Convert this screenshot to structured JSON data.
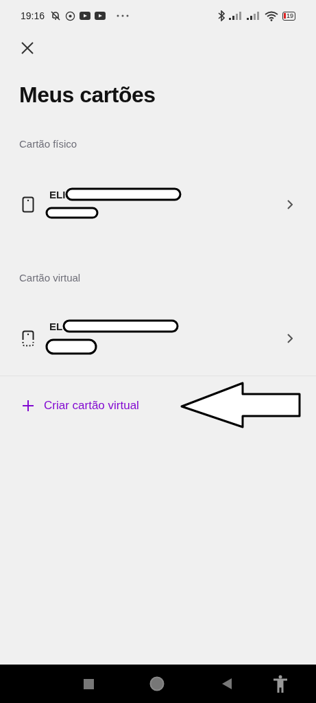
{
  "status_bar": {
    "time": "19:16",
    "battery": "19"
  },
  "title": "Meus cartões",
  "sections": [
    {
      "heading": "Cartão físico",
      "cards": [
        {
          "kind": "physical",
          "name": "ELI"
        }
      ]
    },
    {
      "heading": "Cartão virtual",
      "cards": [
        {
          "kind": "virtual",
          "name": "EL"
        }
      ]
    }
  ],
  "create_action": {
    "label": "Criar cartão virtual"
  }
}
